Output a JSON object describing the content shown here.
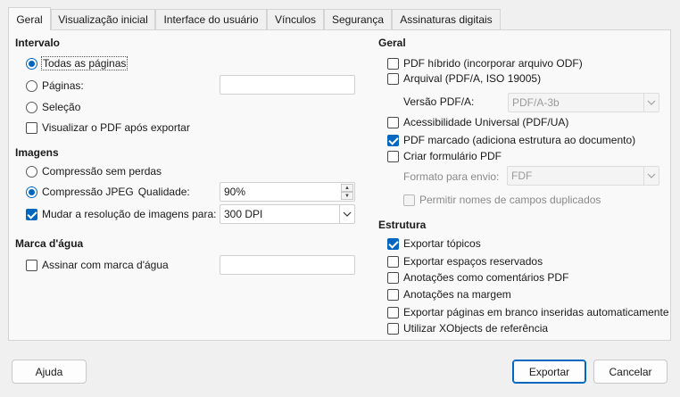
{
  "tabs": [
    "Geral",
    "Visualização inicial",
    "Interface do usuário",
    "Vínculos",
    "Segurança",
    "Assinaturas digitais"
  ],
  "left": {
    "intervalo": {
      "heading": "Intervalo",
      "todas": "Todas as páginas",
      "paginas": "Páginas:",
      "paginas_value": "",
      "selecao": "Seleção",
      "visualizar": "Visualizar o PDF após exportar"
    },
    "imagens": {
      "heading": "Imagens",
      "sem_perdas": "Compressão sem perdas",
      "jpeg": "Compressão JPEG",
      "qualidade": "Qualidade:",
      "qualidade_value": "90%",
      "mudar": "Mudar a resolução de imagens para:",
      "resolucao_value": "300 DPI"
    },
    "marca": {
      "heading": "Marca d'água",
      "assinar": "Assinar com marca d'água",
      "assinar_value": ""
    }
  },
  "right": {
    "geral": {
      "heading": "Geral",
      "hibrido": "PDF híbrido (incorporar arquivo ODF)",
      "arquival": "Arquival (PDF/A, ISO 19005)",
      "versao_label": "Versão PDF/A:",
      "versao_value": "PDF/A-3b",
      "acessibilidade": "Acessibilidade Universal (PDF/UA)",
      "marcado": "PDF marcado (adiciona estrutura ao documento)",
      "formulario": "Criar formulário PDF",
      "formato_label": "Formato para envio:",
      "formato_value": "FDF",
      "duplicados": "Permitir nomes de campos duplicados"
    },
    "estrutura": {
      "heading": "Estrutura",
      "topicos": "Exportar tópicos",
      "espacos": "Exportar espaços reservados",
      "anotacoes_pdf": "Anotações como comentários PDF",
      "anotacoes_margem": "Anotações na margem",
      "paginas_branco": "Exportar páginas em branco inseridas automaticamente",
      "xobjects": "Utilizar XObjects de referência"
    }
  },
  "buttons": {
    "ajuda": "Ajuda",
    "exportar": "Exportar",
    "cancelar": "Cancelar"
  },
  "colors": {
    "accent": "#0067c0"
  }
}
